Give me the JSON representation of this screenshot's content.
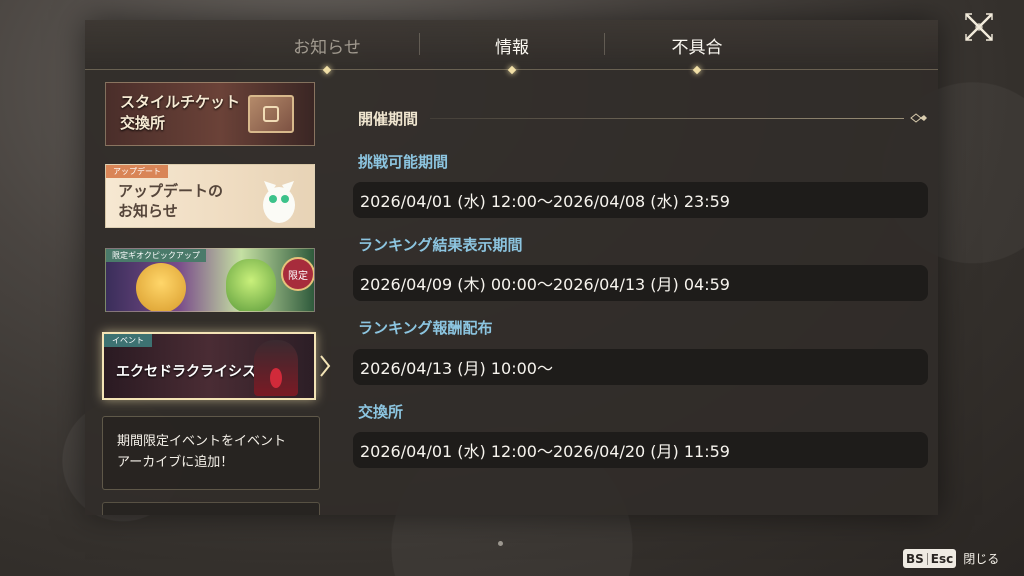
{
  "close_button": {
    "icon": "close-x-icon"
  },
  "tabs": [
    {
      "label": "お知らせ",
      "active": true
    },
    {
      "label": "情報",
      "active": false
    },
    {
      "label": "不具合",
      "active": false
    }
  ],
  "banners": [
    {
      "title": "スタイルチケット\n交換所",
      "icon": "ticket-icon"
    },
    {
      "tag": "アップデート",
      "title": "アップデートの\nお知らせ"
    },
    {
      "tag": "限定ギオクピックアップ",
      "badge": "限定"
    },
    {
      "tag": "イベント",
      "title": "エクセドラクライシス",
      "selected": true
    }
  ],
  "news_item": {
    "text": "期間限定イベントをイベント\nアーカイブに追加！"
  },
  "detail": {
    "section_title": "開催期間",
    "fields": [
      {
        "label": "挑戦可能期間",
        "value": "2026/04/01 (水) 12:00〜2026/04/08 (水) 23:59"
      },
      {
        "label": "ランキング結果表示期間",
        "value": "2026/04/09 (木) 00:00〜2026/04/13 (月) 04:59"
      },
      {
        "label": "ランキング報酬配布",
        "value": "2026/04/13 (月) 10:00〜"
      },
      {
        "label": "交換所",
        "value": "2026/04/01 (水) 12:00〜2026/04/20 (月) 11:59"
      }
    ]
  },
  "footer": {
    "key1": "BS",
    "key2": "Esc",
    "close_label": "閉じる"
  },
  "colors": {
    "accent_blue": "#8cc5e0",
    "gold": "#f1dfa6",
    "panel": "#302c29"
  }
}
